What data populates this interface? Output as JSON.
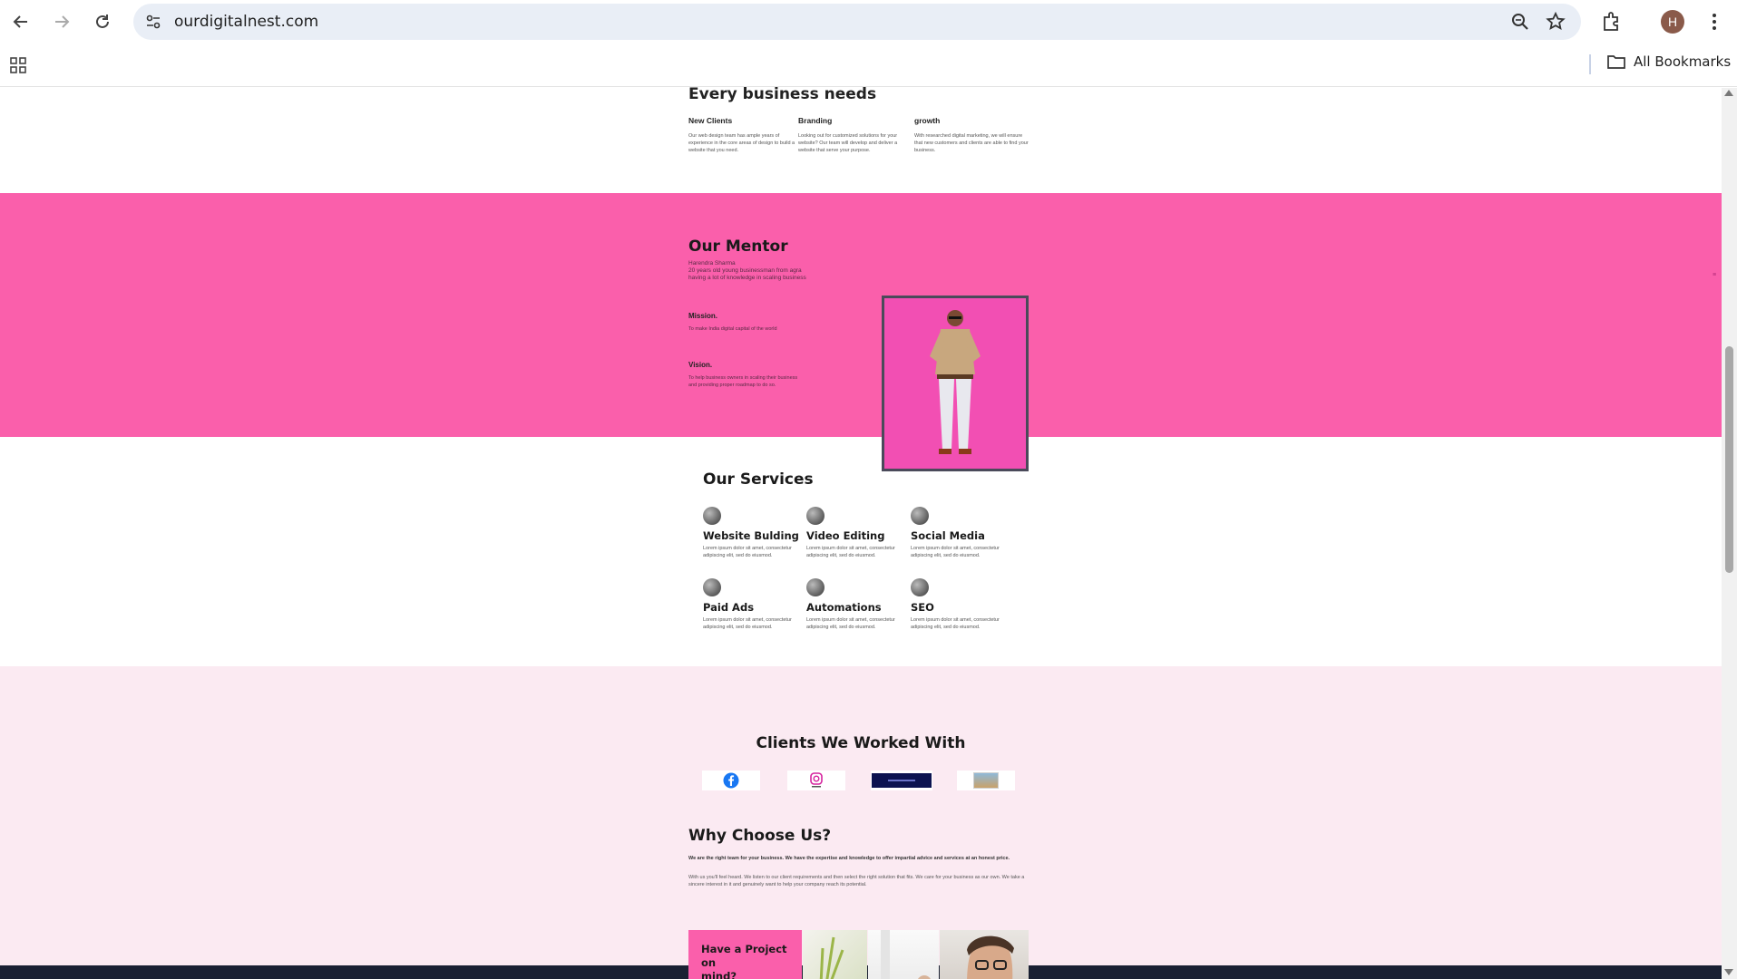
{
  "browser": {
    "url": "ourdigitalnest.com",
    "avatar_letter": "H",
    "bookmarks_label": "All Bookmarks"
  },
  "needs": {
    "title": "Every business needs",
    "items": [
      {
        "title": "New Clients",
        "text": "Our web design team has ample years of experience in the core areas of design to build a website that you need."
      },
      {
        "title": "Branding",
        "text": "Looking out for customized solutions for your website? Our team will develop and deliver a website that serve your purpose."
      },
      {
        "title": "growth",
        "text": "With researched digital marketing, we will ensure that new customers and clients are able to find your business."
      }
    ]
  },
  "mentor": {
    "title": "Our Mentor",
    "name": "Harendra Sharma",
    "line2": "20 years old young businessman from agra",
    "line3": "having a lot of knowledge in scaling business",
    "mission_title": "Mission.",
    "mission_text": "To make India digital capital of the world",
    "vision_title": "Vision.",
    "vision_text": "To help business owners in scaling their business and providing proper roadmap to do so."
  },
  "services": {
    "title": "Our Services",
    "items": [
      {
        "title": "Website Bulding",
        "text": "Lorem ipsum dolor sit amet, consectetur adipiscing elit, sed do eiusmod."
      },
      {
        "title": "Video Editing",
        "text": "Lorem ipsum dolor sit amet, consectetur adipiscing elit, sed do eiusmod."
      },
      {
        "title": "Social Media",
        "text": "Lorem ipsum dolor sit amet, consectetur adipiscing elit, sed do eiusmod."
      },
      {
        "title": "Paid Ads",
        "text": "Lorem ipsum dolor sit amet, consectetur adipiscing elit, sed do eiusmod."
      },
      {
        "title": "Automations",
        "text": "Lorem ipsum dolor sit amet, consectetur adipiscing elit, sed do eiusmod."
      },
      {
        "title": "SEO",
        "text": "Lorem ipsum dolor sit amet, consectetur adipiscing elit, sed do eiusmod."
      }
    ]
  },
  "clients": {
    "title": "Clients We Worked With",
    "logos": [
      "facebook-logo",
      "instagram-logo",
      "dark-brand-logo",
      "photo-logo"
    ]
  },
  "why": {
    "title": "Why Choose Us?",
    "p1": "We are the right team for your business. We have the expertise and knowledge to offer impartial advice and services at an honest price.",
    "p2": "With us you'll feel heard. We listen to our client requirements and then select the right solution that fits. We care for your business as our own. We take a sincere interest in it and genuinely want to help your company reach its potential."
  },
  "project": {
    "line1": "Have a Project on",
    "line2": "mind?"
  },
  "colors": {
    "pink": "#fa5fab",
    "light_pink": "#fbeaf2",
    "footer": "#1a2033"
  }
}
